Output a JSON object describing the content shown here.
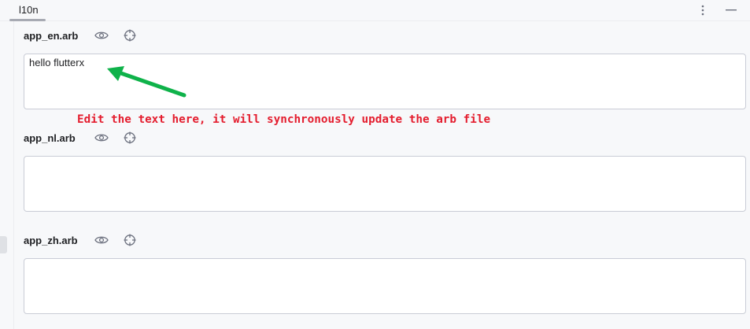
{
  "tab": {
    "label": "l10n"
  },
  "tab_actions": [
    {
      "icon": "more-vertical-icon"
    },
    {
      "icon": "minimize-icon"
    }
  ],
  "sections": [
    {
      "file": "app_en.arb",
      "value": "hello flutterx"
    },
    {
      "file": "app_nl.arb",
      "value": ""
    },
    {
      "file": "app_zh.arb",
      "value": ""
    }
  ],
  "annotation": {
    "text": "Edit the text here, it will synchronously update the arb file",
    "color": "#e41d2e",
    "arrow_color": "#0fb24a"
  }
}
